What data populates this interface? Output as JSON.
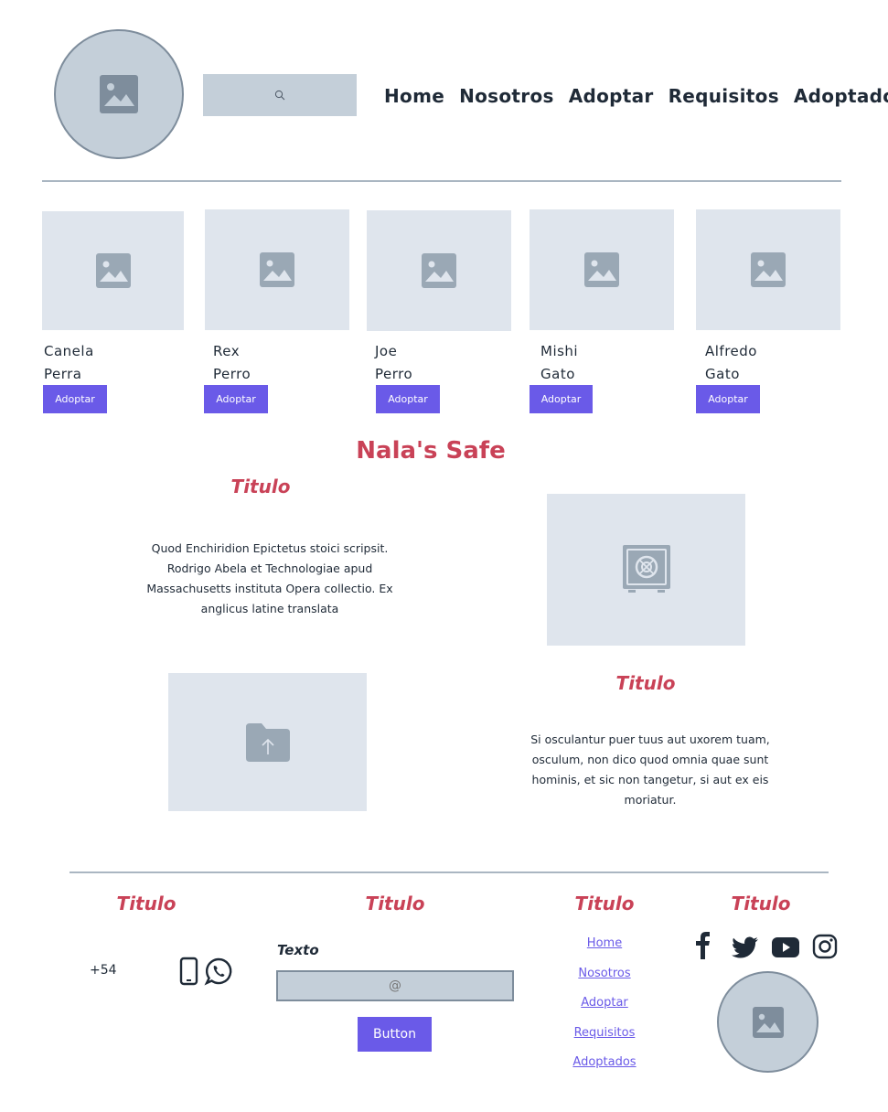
{
  "header": {
    "search": {
      "placeholder": ""
    },
    "nav": [
      {
        "label": "Home"
      },
      {
        "label": "Nosotros"
      },
      {
        "label": "Adoptar"
      },
      {
        "label": "Requisitos"
      },
      {
        "label": "Adoptados"
      }
    ]
  },
  "pets": [
    {
      "name": "Canela",
      "species": "Perra",
      "button": "Adoptar"
    },
    {
      "name": "Rex",
      "species": "Perro",
      "button": "Adoptar"
    },
    {
      "name": "Joe",
      "species": "Perro",
      "button": "Adoptar"
    },
    {
      "name": "Mishi",
      "species": "Gato",
      "button": "Adoptar"
    },
    {
      "name": "Alfredo",
      "species": "Gato",
      "button": "Adoptar"
    }
  ],
  "brand": "Nala's Safe",
  "section1": {
    "title": "Titulo",
    "text": "Quod Enchiridion Epictetus stoici scripsit. Rodrigo Abela et Technologiae apud Massachusetts instituta Opera collectio. Ex anglicus latine translata"
  },
  "section2": {
    "title": "Titulo",
    "text": "Si osculantur puer tuus aut uxorem tuam, osculum, non dico quod omnia quae sunt hominis, et sic non tangetur, si aut ex eis moriatur."
  },
  "footer": {
    "col1": {
      "title": "Titulo",
      "phone": "+54"
    },
    "col2": {
      "title": "Titulo",
      "label": "Texto",
      "email_placeholder": "@",
      "button": "Button"
    },
    "col3": {
      "title": "Titulo",
      "links": [
        {
          "label": "Home"
        },
        {
          "label": "Nosotros"
        },
        {
          "label": "Adoptar"
        },
        {
          "label": "Requisitos"
        },
        {
          "label": "Adoptados"
        }
      ]
    },
    "col4": {
      "title": "Titulo",
      "social_icons": [
        "facebook-icon",
        "twitter-icon",
        "youtube-icon",
        "instagram-icon"
      ]
    }
  },
  "colors": {
    "accent": "#6a5ae8",
    "title_red": "#c94257",
    "placeholder_bg": "#dfe5ed",
    "circle_bg": "#c4cfd9"
  }
}
